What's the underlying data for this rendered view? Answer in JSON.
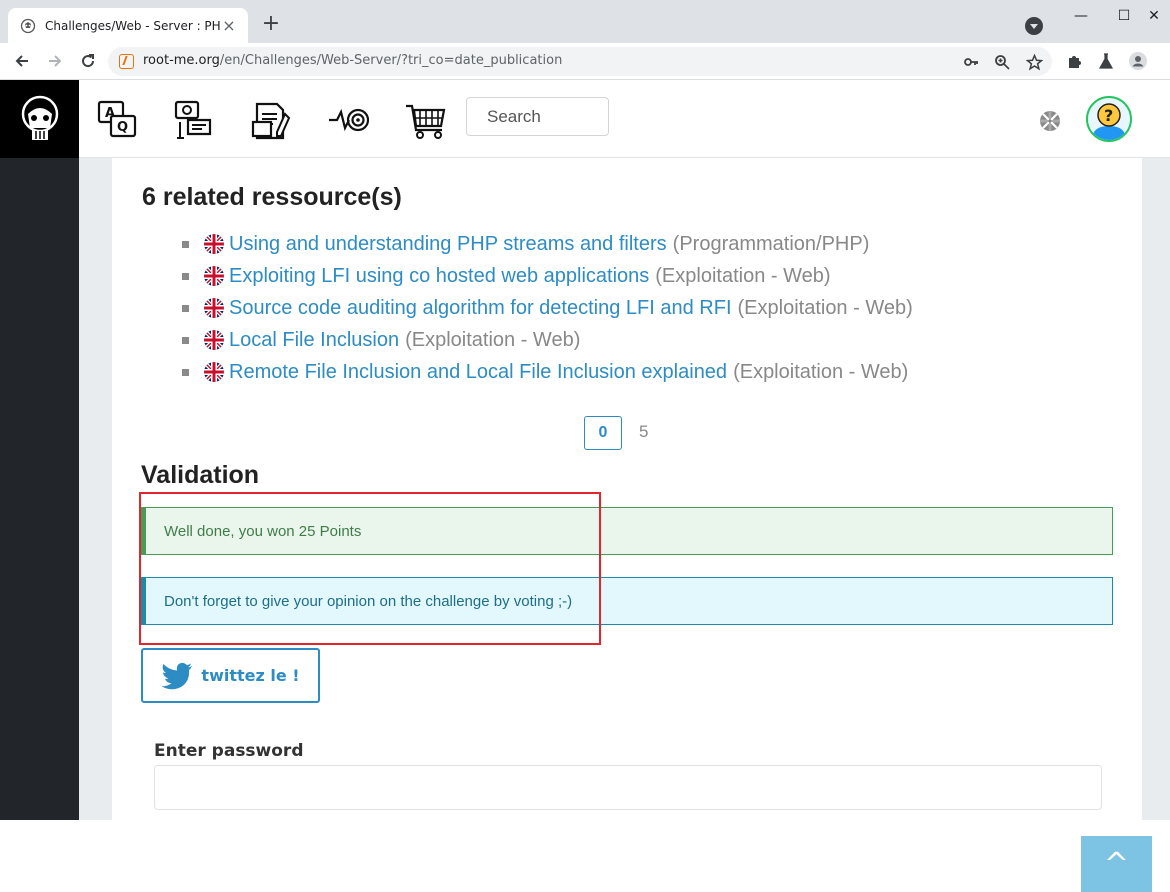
{
  "browser": {
    "tab_title": "Challenges/Web - Server : PHP",
    "tab_close": "×",
    "new_tab": "+",
    "url_host": "root-me.org",
    "url_path": "/en/Challenges/Web-Server/?tri_co=date_publication",
    "window_controls": {
      "minimize": "—",
      "maximize": "☐",
      "close": "✕"
    }
  },
  "site": {
    "search": {
      "placeholder": "Search"
    },
    "nav_icons": [
      "faq-icon",
      "community-icon",
      "documentation-icon",
      "challenges-icon",
      "shop-icon"
    ]
  },
  "resources": {
    "heading": "6 related ressource(s)",
    "items": [
      {
        "title": "Using and understanding PHP streams and filters",
        "category": "(Programmation/PHP)"
      },
      {
        "title": "Exploiting LFI using co hosted web applications",
        "category": "(Exploitation - Web)"
      },
      {
        "title": "Source code auditing algorithm for detecting LFI and RFI",
        "category": "(Exploitation - Web)"
      },
      {
        "title": "Local File Inclusion",
        "category": "(Exploitation - Web)"
      },
      {
        "title": "Remote File Inclusion and Local File Inclusion explained",
        "category": "(Exploitation - Web)"
      }
    ]
  },
  "pagination": {
    "current": "0",
    "next": "5"
  },
  "validation": {
    "heading": "Validation",
    "success_message": "Well done, you won 25 Points",
    "info_message": "Don't forget to give your opinion on the challenge by voting ;-)",
    "tweet_label": "twittez le !"
  },
  "password": {
    "label": "Enter password",
    "value": ""
  },
  "back_to_top": "^",
  "colors": {
    "link": "#2d8cc4",
    "success": "#4a9b57",
    "info": "#1e8aa5",
    "highlight": "#e3262d"
  }
}
